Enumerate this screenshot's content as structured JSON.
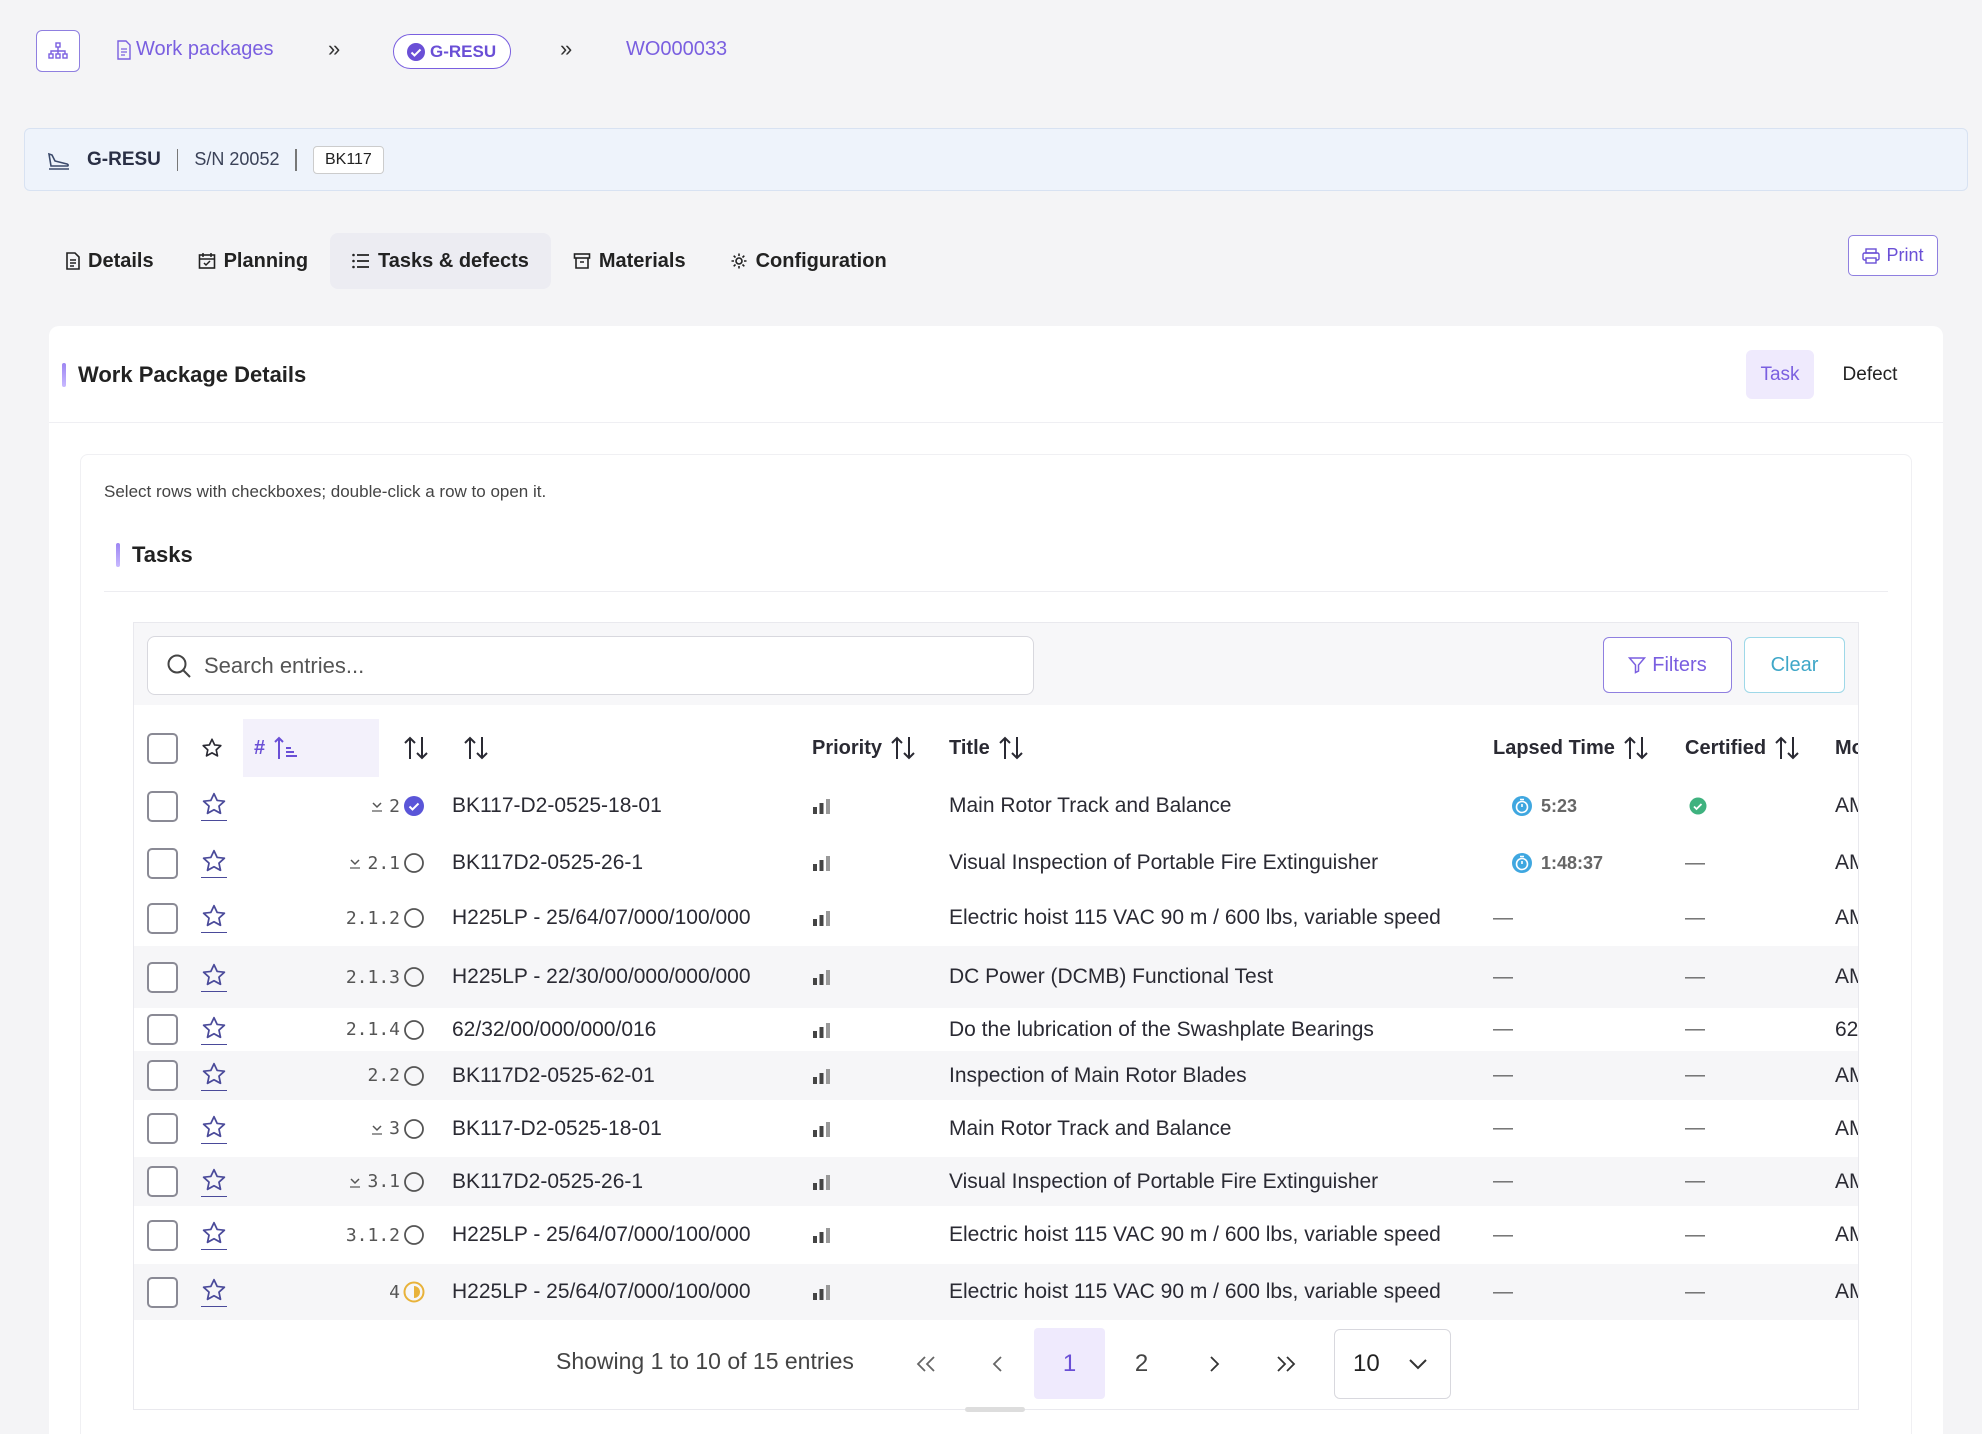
{
  "breadcrumb": {
    "work_packages": "Work packages",
    "aircraft": "G-RESU",
    "work_order": "WO000033"
  },
  "aircraft": {
    "registration": "G-RESU",
    "serial": "S/N 20052",
    "type": "BK117"
  },
  "tabs": [
    {
      "label": "Details",
      "icon": "document-icon"
    },
    {
      "label": "Planning",
      "icon": "calendar-icon"
    },
    {
      "label": "Tasks & defects",
      "icon": "list-icon",
      "active": true
    },
    {
      "label": "Materials",
      "icon": "box-icon"
    },
    {
      "label": "Configuration",
      "icon": "gear-icon"
    }
  ],
  "print_label": "Print",
  "card": {
    "title": "Work Package Details",
    "toggle_task": "Task",
    "toggle_defect": "Defect",
    "hint": "Select rows with checkboxes; double-click a row to open it.",
    "section_title": "Tasks"
  },
  "search": {
    "placeholder": "Search entries..."
  },
  "filters_label": "Filters",
  "clear_label": "Clear",
  "columns": {
    "number": "#",
    "priority": "Priority",
    "title": "Title",
    "lapsed": "Lapsed Time",
    "certified": "Certified",
    "more": "Mo"
  },
  "rows": [
    {
      "num": "2",
      "expand": true,
      "status": "done",
      "code": "BK117-D2-0525-18-01",
      "title": "Main Rotor Track and Balance",
      "lapsed": "5:23",
      "certified": true,
      "more": "AM"
    },
    {
      "num": "2.1",
      "expand": true,
      "status": "open",
      "code": "BK117D2-0525-26-1",
      "title": "Visual Inspection of Portable Fire Extinguisher",
      "lapsed": "1:48:37",
      "certified": false,
      "more": "AM"
    },
    {
      "num": "2.1.2",
      "expand": false,
      "status": "open",
      "code": "H225LP - 25/64/07/000/100/000",
      "title": "Electric hoist 115 VAC 90 m / 600 lbs, variable speed",
      "lapsed": "",
      "certified": false,
      "more": "AM"
    },
    {
      "num": "2.1.3",
      "expand": false,
      "status": "open",
      "code": "H225LP - 22/30/00/000/000/000",
      "title": "DC Power (DCMB) Functional Test",
      "lapsed": "",
      "certified": false,
      "more": "AM"
    },
    {
      "num": "2.1.4",
      "expand": false,
      "status": "open",
      "code": "62/32/00/000/000/016",
      "title": "Do the lubrication of the Swashplate Bearings",
      "lapsed": "",
      "certified": false,
      "more": "62"
    },
    {
      "num": "2.2",
      "expand": false,
      "status": "open",
      "code": "BK117D2-0525-62-01",
      "title": "Inspection of Main Rotor Blades",
      "lapsed": "",
      "certified": false,
      "more": "AM"
    },
    {
      "num": "3",
      "expand": true,
      "status": "open",
      "code": "BK117-D2-0525-18-01",
      "title": "Main Rotor Track and Balance",
      "lapsed": "",
      "certified": false,
      "more": "AM"
    },
    {
      "num": "3.1",
      "expand": true,
      "status": "open",
      "code": "BK117D2-0525-26-1",
      "title": "Visual Inspection of Portable Fire Extinguisher",
      "lapsed": "",
      "certified": false,
      "more": "AM"
    },
    {
      "num": "3.1.2",
      "expand": false,
      "status": "open",
      "code": "H225LP - 25/64/07/000/100/000",
      "title": "Electric hoist 115 VAC 90 m / 600 lbs, variable speed",
      "lapsed": "",
      "certified": false,
      "more": "AM"
    },
    {
      "num": "4",
      "expand": false,
      "status": "in-progress",
      "code": "H225LP - 25/64/07/000/100/000",
      "title": "Electric hoist 115 VAC 90 m / 600 lbs, variable speed",
      "lapsed": "",
      "certified": false,
      "more": "AM"
    }
  ],
  "pagination": {
    "info": "Showing 1 to 10 of 15 entries",
    "first": "«",
    "prev": "‹",
    "pages": [
      "1",
      "2"
    ],
    "current": "1",
    "next": "›",
    "last": "»",
    "page_size": "10"
  },
  "colors": {
    "accent": "#7a5fe0",
    "done": "#5a55d8",
    "in_progress": "#e8b23a",
    "certified": "#3fb27f",
    "timer": "#3fa7e0"
  }
}
